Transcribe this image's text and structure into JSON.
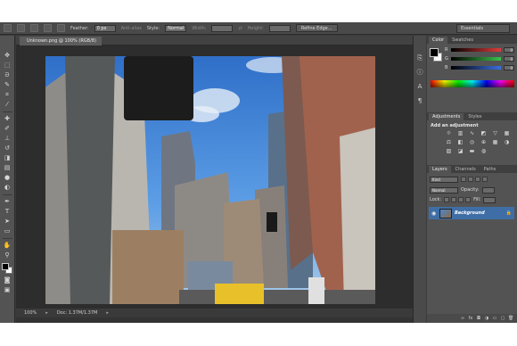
{
  "options_bar": {
    "feather_label": "Feather:",
    "feather_value": "0 px",
    "antialias_label": "Anti-alias",
    "style_label": "Style:",
    "style_value": "Normal",
    "width_label": "Width:",
    "height_label": "Height:",
    "refine_edge_label": "Refine Edge...",
    "workspace_value": "Essentials"
  },
  "document": {
    "tab_title": "Unknown.png @ 100% (RGB/8)",
    "zoom": "100%",
    "doc_size": "Doc: 1.37M/1.37M"
  },
  "color_panel": {
    "tabs": [
      "Color",
      "Swatches"
    ],
    "channels": [
      {
        "label": "R",
        "value": "0",
        "color": "#e03a3a"
      },
      {
        "label": "G",
        "value": "0",
        "color": "#3ac24a"
      },
      {
        "label": "B",
        "value": "0",
        "color": "#3a6ee0"
      }
    ]
  },
  "adjustments_panel": {
    "tabs": [
      "Adjustments",
      "Styles"
    ],
    "add_label": "Add an adjustment"
  },
  "layers_panel": {
    "tabs": [
      "Layers",
      "Channels",
      "Paths"
    ],
    "kind_value": "Kind",
    "blend_value": "Normal",
    "opacity_label": "Opacity:",
    "lock_label": "Lock:",
    "fill_label": "Fill:",
    "layer_name": "Background"
  },
  "colors": {
    "foreground": "#000000",
    "background": "#ffffff",
    "layer_selected": "#3f6ea6"
  }
}
